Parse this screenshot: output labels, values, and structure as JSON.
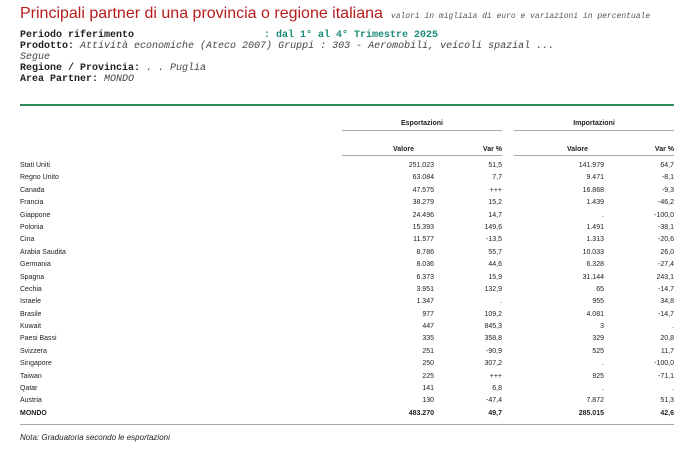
{
  "title": "Principali partner di una provincia o regione italiana",
  "subtitle": "valori in migliaia di euro e variazioni in percentuale",
  "meta": {
    "periodo_label": "Periodo riferimento",
    "periodo_value": ": dal 1° al 4° Trimestre 2025",
    "prodotto_label": "Prodotto:",
    "prodotto_value": "Attività economiche (Ateco 2007) Gruppi : 303 - Aeromobili, veicoli spazial ...",
    "prodotto_more": "Segue",
    "regione_label": "Regione / Provincia:",
    "regione_value": ". . Puglia",
    "area_label": "Area Partner:",
    "area_value": "MONDO"
  },
  "groups": {
    "export": "Esportazioni",
    "import": "Importazioni"
  },
  "headers": {
    "export_valore": "Valore",
    "export_var": "Var %",
    "import_valore": "Valore",
    "import_var": "Var %"
  },
  "rows": [
    {
      "name": "Stati Uniti",
      "ev": "251.023",
      "evar": "51,5",
      "iv": "141.979",
      "ivar": "64,7"
    },
    {
      "name": "Regno Unito",
      "ev": "63.084",
      "evar": "7,7",
      "iv": "9.471",
      "ivar": "-8,1"
    },
    {
      "name": "Canada",
      "ev": "47.575",
      "evar": "+++",
      "iv": "16.868",
      "ivar": "-9,3"
    },
    {
      "name": "Francia",
      "ev": "38.279",
      "evar": "15,2",
      "iv": "1.439",
      "ivar": "-46,2"
    },
    {
      "name": "Giappone",
      "ev": "24.496",
      "evar": "14,7",
      "iv": ".",
      "ivar": "-100,0"
    },
    {
      "name": "Polonia",
      "ev": "15.393",
      "evar": "149,6",
      "iv": "1.491",
      "ivar": "-38,1"
    },
    {
      "name": "Cina",
      "ev": "11.577",
      "evar": "-13,5",
      "iv": "1.313",
      "ivar": "-20,6"
    },
    {
      "name": "Arabia Saudita",
      "ev": "8.786",
      "evar": "55,7",
      "iv": "10.033",
      "ivar": "26,0"
    },
    {
      "name": "Germania",
      "ev": "8.036",
      "evar": "44,6",
      "iv": "6.328",
      "ivar": "-27,4"
    },
    {
      "name": "Spagna",
      "ev": "6.373",
      "evar": "15,9",
      "iv": "31.144",
      "ivar": "243,1"
    },
    {
      "name": "Cechia",
      "ev": "3.951",
      "evar": "132,9",
      "iv": "65",
      "ivar": "-14,7"
    },
    {
      "name": "Israele",
      "ev": "1.347",
      "evar": ".",
      "iv": "955",
      "ivar": "34,8"
    },
    {
      "name": "Brasile",
      "ev": "977",
      "evar": "109,2",
      "iv": "4.081",
      "ivar": "-14,7"
    },
    {
      "name": "Kuwait",
      "ev": "447",
      "evar": "845,3",
      "iv": "3",
      "ivar": "."
    },
    {
      "name": "Paesi Bassi",
      "ev": "335",
      "evar": "358,8",
      "iv": "329",
      "ivar": "20,8"
    },
    {
      "name": "Svizzera",
      "ev": "251",
      "evar": "-90,9",
      "iv": "525",
      "ivar": "11,7"
    },
    {
      "name": "Singapore",
      "ev": "250",
      "evar": "307,2",
      "iv": ".",
      "ivar": "-100,0"
    },
    {
      "name": "Taiwan",
      "ev": "225",
      "evar": "+++",
      "iv": "925",
      "ivar": "-71,1"
    },
    {
      "name": "Qatar",
      "ev": "141",
      "evar": "6,8",
      "iv": ".",
      "ivar": "."
    },
    {
      "name": "Austria",
      "ev": "130",
      "evar": "-47,4",
      "iv": "7.872",
      "ivar": "51,3"
    }
  ],
  "total": {
    "name": "MONDO",
    "ev": "483.270",
    "evar": "49,7",
    "iv": "285.015",
    "ivar": "42,6"
  },
  "note": "Nota: Graduatoria secondo le esportazioni",
  "colors": {
    "title": "#b71c1c",
    "period": "#1a8a78",
    "rule": "#2e8b57"
  }
}
